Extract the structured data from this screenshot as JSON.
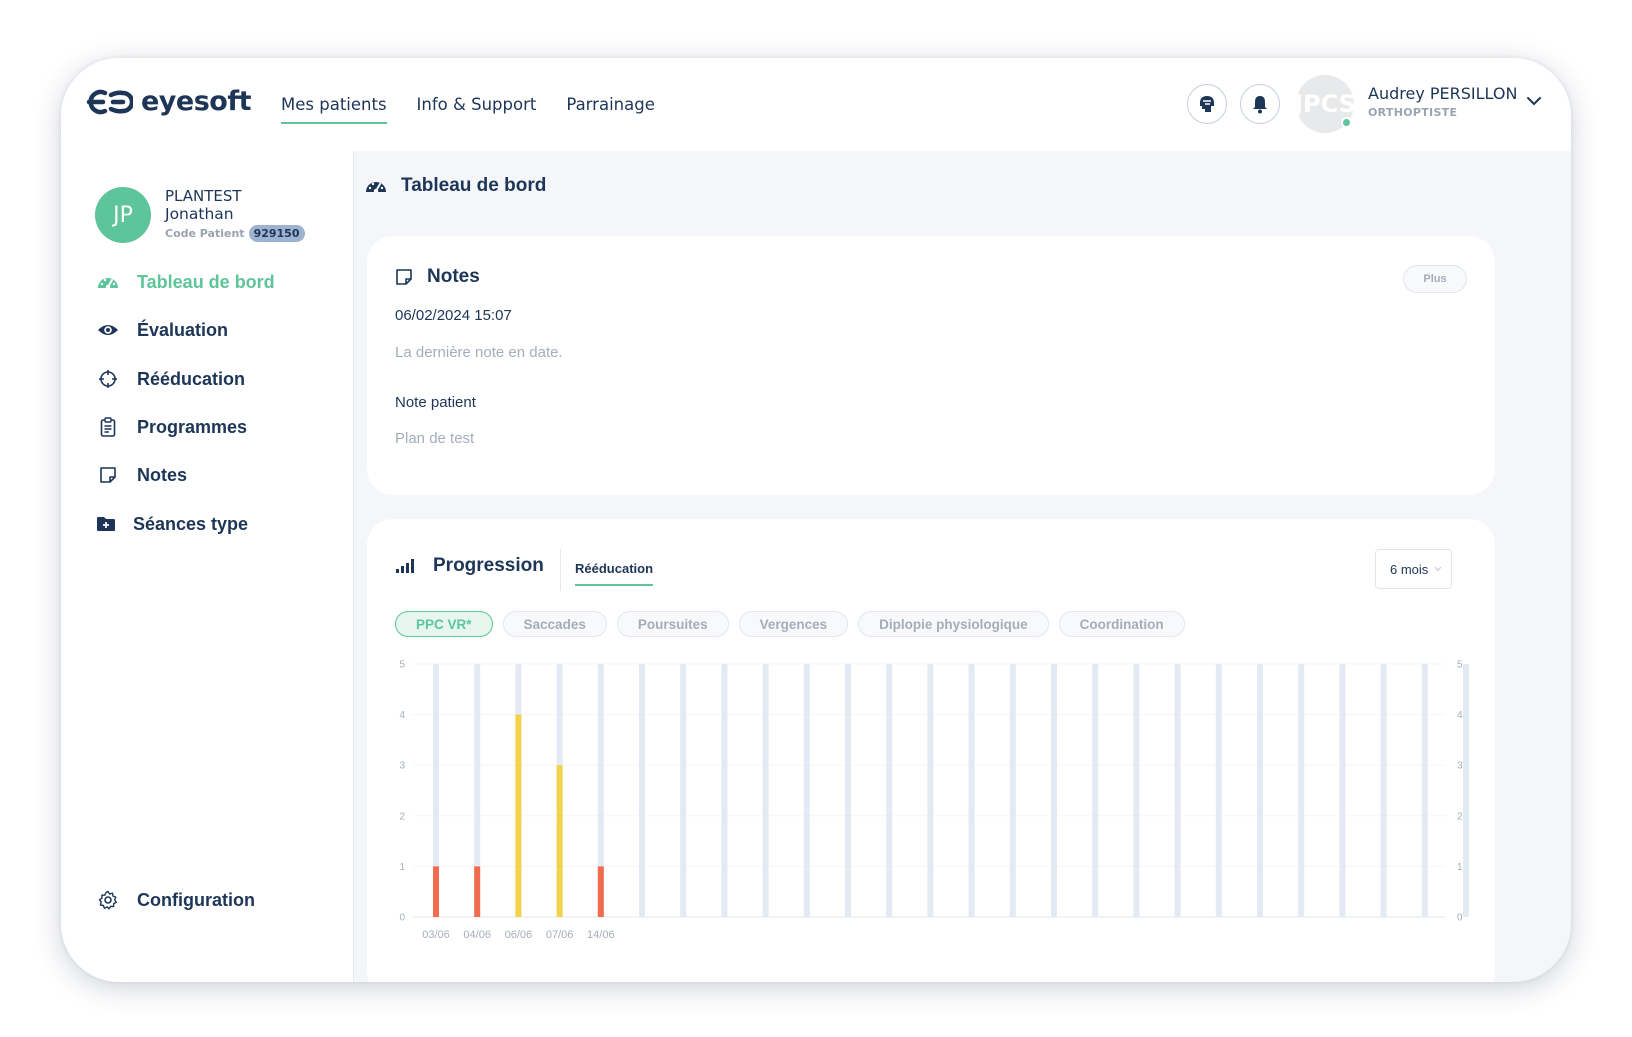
{
  "header": {
    "logo_text": "eyesoft",
    "nav": [
      {
        "label": "Mes patients",
        "active": true
      },
      {
        "label": "Info & Support",
        "active": false
      },
      {
        "label": "Parrainage",
        "active": false
      }
    ],
    "icons": [
      "brain-head-icon",
      "bell-icon"
    ],
    "user": {
      "initials": "JPCS",
      "name": "Audrey PERSILLON",
      "role": "ORTHOPTISTE",
      "online": true
    }
  },
  "patient": {
    "initials": "JP",
    "last_name": "PLANTEST",
    "first_name": "Jonathan",
    "code_label": "Code Patient",
    "code": "929150"
  },
  "sidebar": {
    "items": [
      {
        "label": "Tableau de bord",
        "icon": "gauge-icon",
        "active": true
      },
      {
        "label": "Évaluation",
        "icon": "eye-icon",
        "active": false
      },
      {
        "label": "Rééducation",
        "icon": "crosshair-icon",
        "active": false
      },
      {
        "label": "Programmes",
        "icon": "clipboard-icon",
        "active": false
      },
      {
        "label": "Notes",
        "icon": "sticky-note-icon",
        "active": false
      },
      {
        "label": "Séances type",
        "icon": "folder-plus-icon",
        "active": false
      }
    ],
    "footer_item": {
      "label": "Configuration",
      "icon": "gear-icon"
    }
  },
  "page_title": "Tableau de bord",
  "notes_card": {
    "title": "Notes",
    "more_label": "Plus",
    "date": "06/02/2024 15:07",
    "subtitle": "La dernière note en date.",
    "label": "Note patient",
    "value": "Plan de test"
  },
  "progression_card": {
    "title": "Progression",
    "tab": "Rééducation",
    "period": "6 mois",
    "filters": [
      {
        "label": "PPC VR*",
        "active": true
      },
      {
        "label": "Saccades",
        "active": false
      },
      {
        "label": "Poursuites",
        "active": false
      },
      {
        "label": "Vergences",
        "active": false
      },
      {
        "label": "Diplopie physiologique",
        "active": false
      },
      {
        "label": "Coordination",
        "active": false
      }
    ]
  },
  "colors": {
    "accent": "#5ec49a",
    "navy": "#1d3557",
    "bar_low": "#f26b4f",
    "bar_mid": "#f2d24a",
    "bar_track": "#e3eaf4"
  },
  "chart_data": {
    "type": "bar",
    "ylim": [
      0,
      5
    ],
    "yticks": [
      "0",
      "1",
      "2",
      "3",
      "4",
      "5"
    ],
    "categories": [
      "03/06",
      "04/06",
      "06/06",
      "07/06",
      "14/06",
      "",
      "",
      "",
      "",
      "",
      "",
      "",
      "",
      "",
      "",
      "",
      "",
      "",
      "",
      "",
      "",
      "",
      "",
      "",
      "",
      ""
    ],
    "values": [
      1,
      1,
      4,
      3,
      1,
      null,
      null,
      null,
      null,
      null,
      null,
      null,
      null,
      null,
      null,
      null,
      null,
      null,
      null,
      null,
      null,
      null,
      null,
      null,
      null,
      null
    ],
    "bar_colors": [
      "#f26b4f",
      "#f26b4f",
      "#f2d24a",
      "#f2d24a",
      "#f26b4f"
    ],
    "grid": true,
    "legend": "none"
  }
}
